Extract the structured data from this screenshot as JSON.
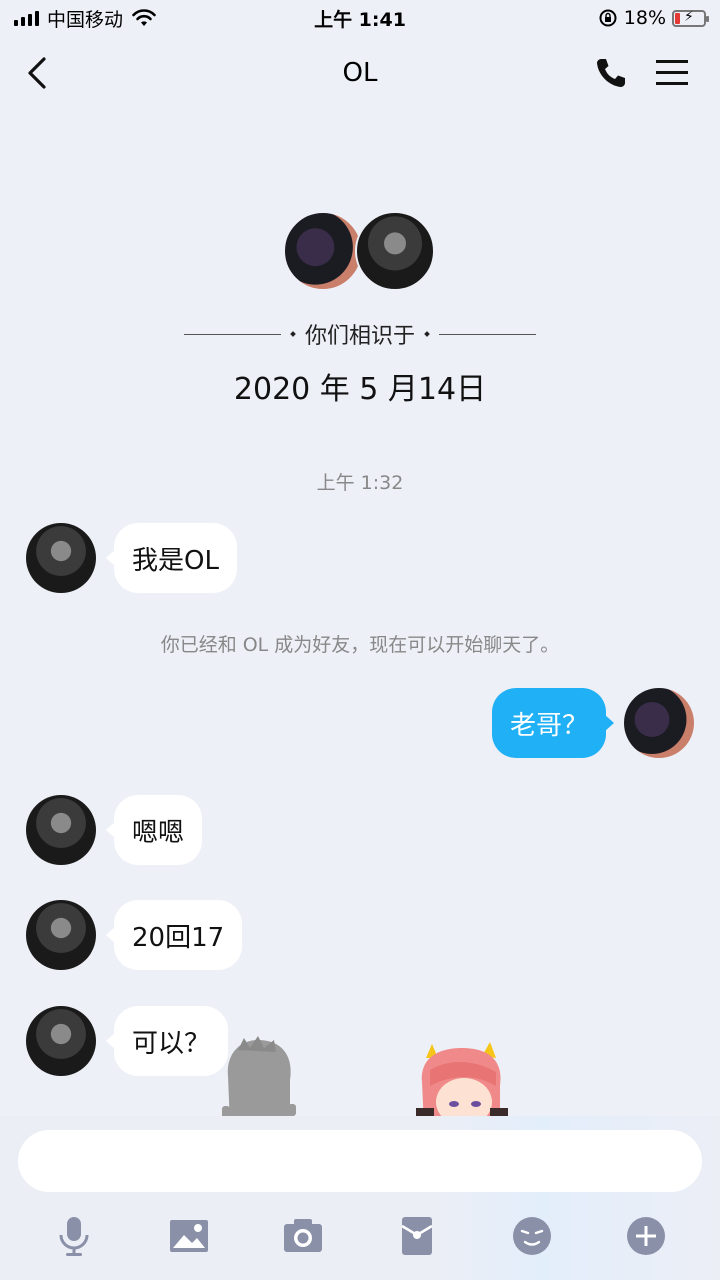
{
  "status_bar": {
    "carrier": "中国移动",
    "time": "上午 1:41",
    "battery_text": "18%"
  },
  "nav": {
    "title": "OL"
  },
  "intro": {
    "met_label": "你们相识于",
    "met_date": "2020 年 5 月14日"
  },
  "chat": {
    "timestamp": "上午 1:32",
    "messages": [
      {
        "from": "friend",
        "text": "我是OL"
      },
      {
        "from": "me",
        "text": "老哥？"
      },
      {
        "from": "friend",
        "text": "嗯嗯"
      },
      {
        "from": "friend",
        "text": "20回17"
      },
      {
        "from": "friend",
        "text": "可以？"
      }
    ],
    "system_note": "你已经和 OL 成为好友，现在可以开始聊天了。"
  },
  "input": {
    "placeholder": ""
  },
  "toolbar": {
    "icons": [
      "microphone-icon",
      "image-icon",
      "camera-icon",
      "red-packet-icon",
      "emoji-icon",
      "plus-icon"
    ]
  },
  "colors": {
    "accent": "#20b0f5",
    "background": "#eef0f8",
    "icon_gray": "#8a90a8",
    "battery_low": "#e53935"
  }
}
